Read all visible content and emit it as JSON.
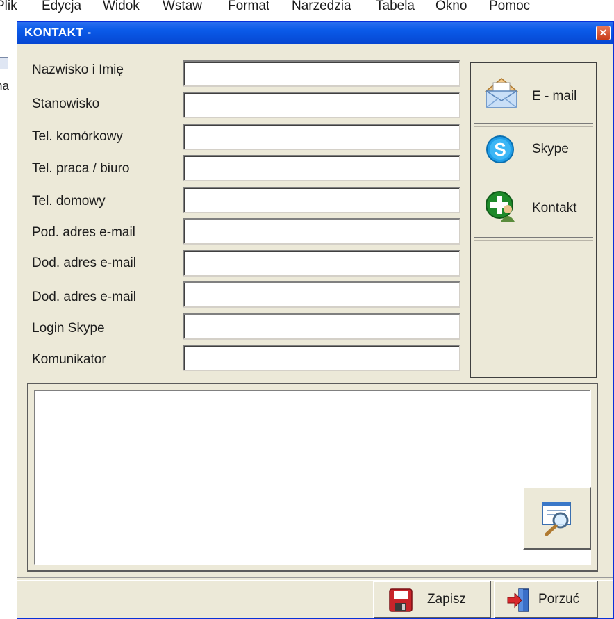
{
  "background_app": {
    "menu": [
      "Plik",
      "Edycja",
      "Widok",
      "Wstaw",
      "Format",
      "Narzedzia",
      "Tabela",
      "Okno",
      "Pomoc"
    ],
    "left_fragment": "na"
  },
  "dialog": {
    "title": "KONTAKT -",
    "close_glyph": "✕",
    "fields": [
      {
        "label": "Nazwisko i Imię",
        "value": ""
      },
      {
        "label": "Stanowisko",
        "value": ""
      },
      {
        "label": "Tel. komórkowy",
        "value": ""
      },
      {
        "label": "Tel. praca / biuro",
        "value": ""
      },
      {
        "label": "Tel. domowy",
        "value": ""
      },
      {
        "label": "Pod. adres e-mail",
        "value": ""
      },
      {
        "label": "Dod. adres e-mail",
        "value": ""
      },
      {
        "label": "Dod. adres e-mail",
        "value": ""
      },
      {
        "label": "Login Skype",
        "value": ""
      },
      {
        "label": "Komunikator",
        "value": ""
      }
    ],
    "actions": {
      "email": {
        "label": "E - mail",
        "icon": "envelope-icon"
      },
      "skype": {
        "label": "Skype",
        "icon": "skype-icon",
        "icon_letter": "S"
      },
      "contact": {
        "label": "Kontakt",
        "icon": "add-contact-icon"
      }
    },
    "memo": {
      "value": ""
    },
    "buttons": {
      "save": {
        "label_first": "Z",
        "label_rest": "apisz",
        "icon": "floppy-disk-icon"
      },
      "cancel": {
        "label_first": "P",
        "label_rest": "orzuć",
        "icon": "exit-door-icon"
      }
    }
  }
}
